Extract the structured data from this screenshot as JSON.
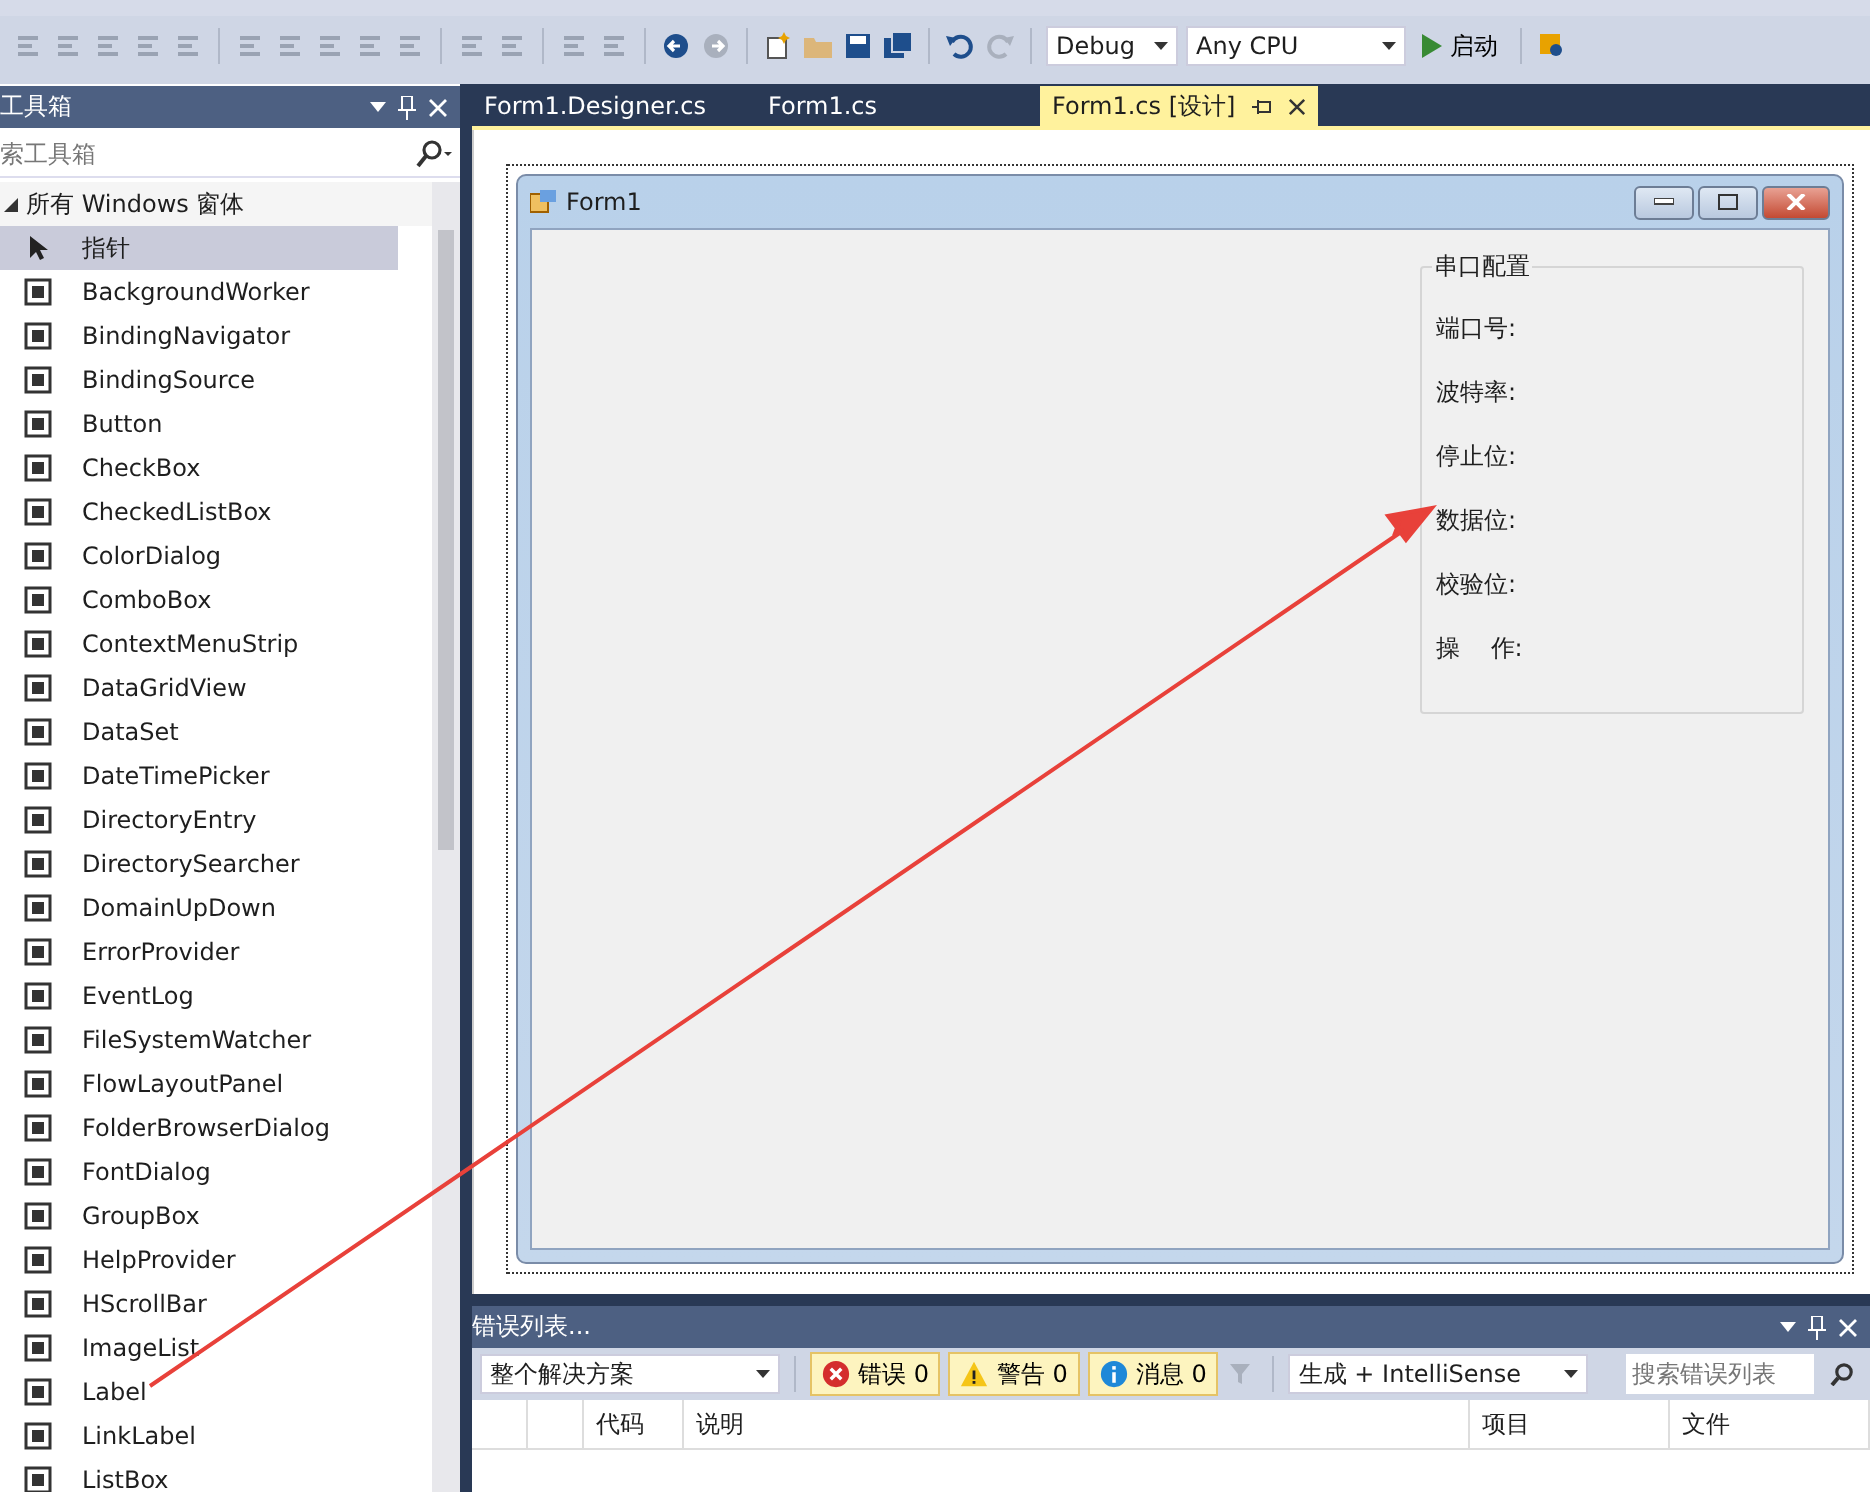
{
  "toolbar": {
    "configuration": "Debug",
    "platform": "Any CPU",
    "start_label": "启动"
  },
  "toolbox": {
    "title": "工具箱",
    "search": {
      "placeholder": "索工具箱"
    },
    "group": {
      "label": "所有 Windows 窗体",
      "expanded": true,
      "items": [
        {
          "label": "指针",
          "selected": true
        },
        {
          "label": "BackgroundWorker",
          "selected": false
        },
        {
          "label": "BindingNavigator",
          "selected": false
        },
        {
          "label": "BindingSource",
          "selected": false
        },
        {
          "label": "Button",
          "selected": false
        },
        {
          "label": "CheckBox",
          "selected": false
        },
        {
          "label": "CheckedListBox",
          "selected": false
        },
        {
          "label": "ColorDialog",
          "selected": false
        },
        {
          "label": "ComboBox",
          "selected": false
        },
        {
          "label": "ContextMenuStrip",
          "selected": false
        },
        {
          "label": "DataGridView",
          "selected": false
        },
        {
          "label": "DataSet",
          "selected": false
        },
        {
          "label": "DateTimePicker",
          "selected": false
        },
        {
          "label": "DirectoryEntry",
          "selected": false
        },
        {
          "label": "DirectorySearcher",
          "selected": false
        },
        {
          "label": "DomainUpDown",
          "selected": false
        },
        {
          "label": "ErrorProvider",
          "selected": false
        },
        {
          "label": "EventLog",
          "selected": false
        },
        {
          "label": "FileSystemWatcher",
          "selected": false
        },
        {
          "label": "FlowLayoutPanel",
          "selected": false
        },
        {
          "label": "FolderBrowserDialog",
          "selected": false
        },
        {
          "label": "FontDialog",
          "selected": false
        },
        {
          "label": "GroupBox",
          "selected": false
        },
        {
          "label": "HelpProvider",
          "selected": false
        },
        {
          "label": "HScrollBar",
          "selected": false
        },
        {
          "label": "ImageList",
          "selected": false
        },
        {
          "label": "Label",
          "selected": false
        },
        {
          "label": "LinkLabel",
          "selected": false
        },
        {
          "label": "ListBox",
          "selected": false
        }
      ]
    }
  },
  "tabs": [
    {
      "label": "Form1.Designer.cs",
      "selected": false
    },
    {
      "label": "Form1.cs",
      "selected": false
    },
    {
      "label": "Form1.cs [设计]",
      "selected": true
    }
  ],
  "form": {
    "title": "Form1",
    "group_box": {
      "title": "串口配置",
      "labels": [
        "端口号:",
        "波特率:",
        "停止位:",
        "数据位:",
        "校验位:",
        "操    作:"
      ]
    }
  },
  "error_list": {
    "title": "错误列表...",
    "scope": "整个解决方案",
    "filters": [
      {
        "kind": "error",
        "label": "错误 0",
        "selected": true
      },
      {
        "kind": "warning",
        "label": "警告 0",
        "selected": true
      },
      {
        "kind": "message",
        "label": "消息 0",
        "selected": true
      }
    ],
    "source": "生成 + IntelliSense",
    "search": {
      "placeholder": "搜索错误列表"
    },
    "columns": [
      "",
      "",
      "代码",
      "说明",
      "项目",
      "文件"
    ]
  }
}
